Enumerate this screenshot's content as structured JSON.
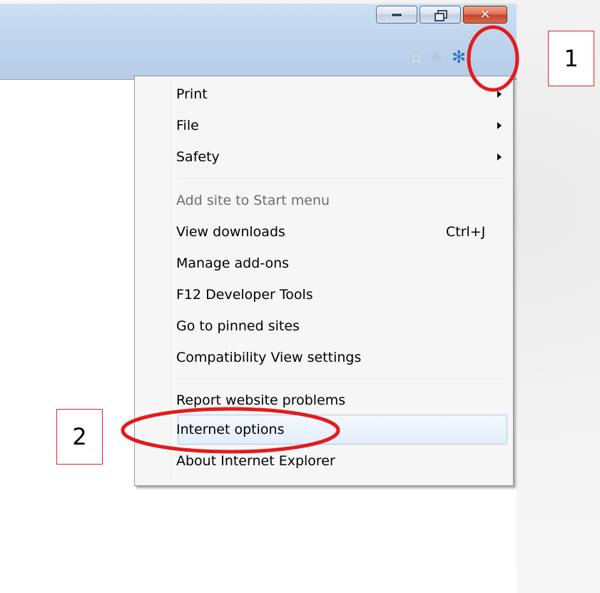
{
  "window": {
    "caption_buttons": [
      {
        "name": "minimize",
        "icon": "minimize-icon"
      },
      {
        "name": "restore",
        "icon": "restore-icon"
      },
      {
        "name": "close",
        "icon": "close-icon",
        "glyph": "✕"
      }
    ],
    "toolbar_icons": [
      {
        "name": "home",
        "icon": "home-icon",
        "glyph": "⌂"
      },
      {
        "name": "favorites",
        "icon": "star-icon",
        "glyph": "☆"
      },
      {
        "name": "tools",
        "icon": "gear-icon",
        "glyph": "✻"
      }
    ]
  },
  "menu": {
    "items": [
      {
        "label": "Print",
        "submenu": true
      },
      {
        "label": "File",
        "submenu": true
      },
      {
        "label": "Safety",
        "submenu": true
      },
      {
        "label": "Add site to Start menu",
        "disabled": true
      },
      {
        "label": "View downloads",
        "shortcut": "Ctrl+J"
      },
      {
        "label": "Manage add-ons"
      },
      {
        "label": "F12 Developer Tools"
      },
      {
        "label": "Go to pinned sites"
      },
      {
        "label": "Compatibility View settings"
      },
      {
        "label": "Report website problems"
      },
      {
        "label": "Internet options",
        "highlighted": true
      },
      {
        "label": "About Internet Explorer"
      }
    ]
  },
  "annotations": {
    "callout_1": "1",
    "callout_2": "2",
    "highlight_color": "#e31b1b"
  }
}
